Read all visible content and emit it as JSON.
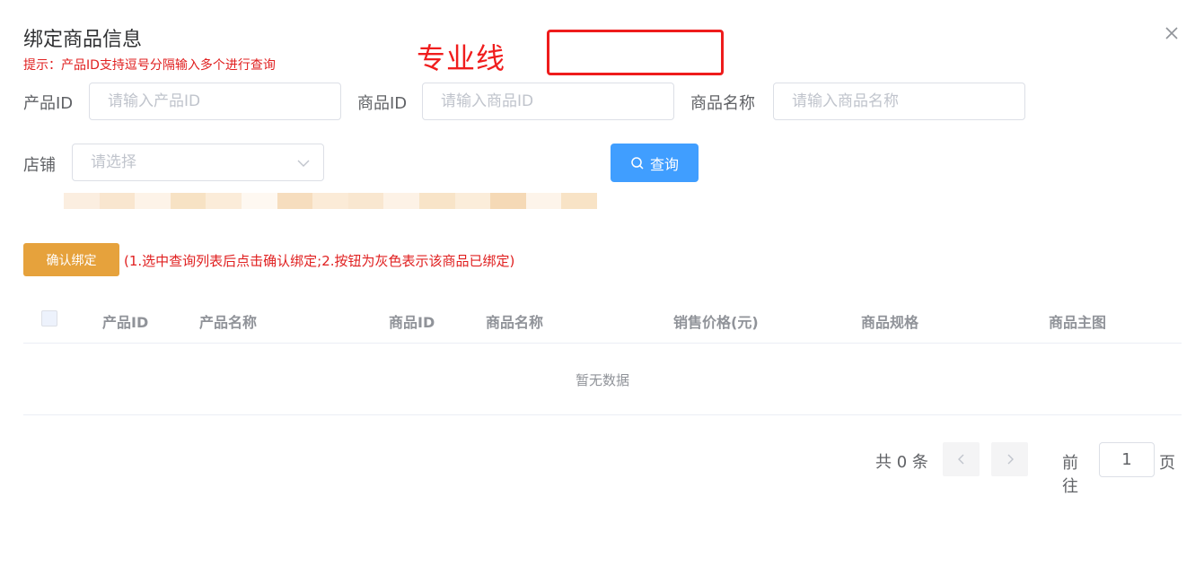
{
  "dialog": {
    "title": "绑定商品信息",
    "tip": "提示：产品ID支持逗号分隔输入多个进行查询",
    "annotation": "专业线"
  },
  "form": {
    "product_id_label": "产品ID",
    "product_id_placeholder": "请输入产品ID",
    "goods_id_label": "商品ID",
    "goods_id_placeholder": "请输入商品ID",
    "goods_name_label": "商品名称",
    "goods_name_placeholder": "请输入商品名称",
    "shop_label": "店铺",
    "shop_placeholder": "请选择",
    "search_label": "查询"
  },
  "actions": {
    "bind_label": "确认绑定",
    "bind_note": "(1.选中查询列表后点击确认绑定;2.按钮为灰色表示该商品已绑定)"
  },
  "table": {
    "columns": [
      "产品ID",
      "产品名称",
      "商品ID",
      "商品名称",
      "销售价格(元)",
      "商品规格",
      "商品主图"
    ],
    "rows": [],
    "empty_text": "暂无数据"
  },
  "pagination": {
    "total_text": "共 0 条",
    "goto_label": "前往",
    "current_page": "1",
    "page_unit": "页"
  },
  "colors": {
    "primary": "#409eff",
    "warning": "#e6a23c",
    "danger": "#e02020",
    "annotation_red": "#ee1c1c"
  }
}
